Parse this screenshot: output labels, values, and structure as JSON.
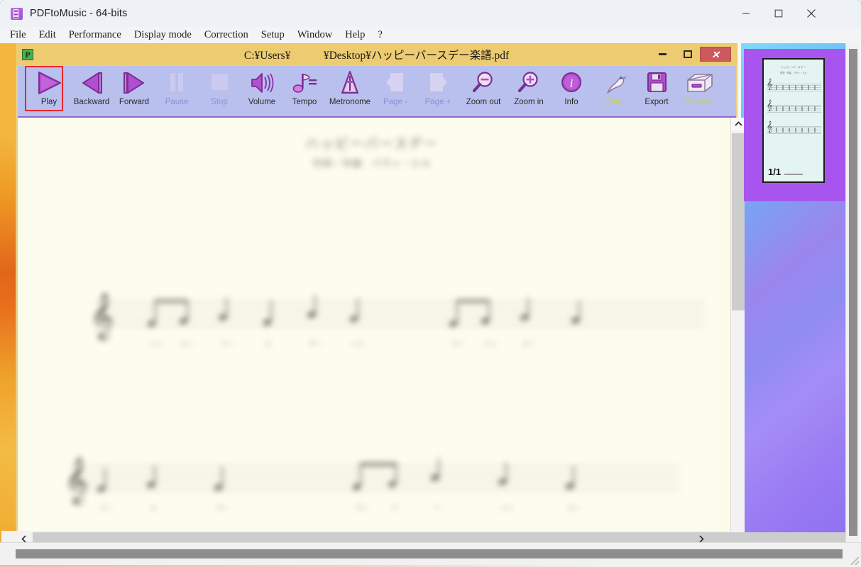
{
  "window": {
    "title": "PDFtoMusic - 64-bits",
    "app_icon": "pdf-icon",
    "controls": {
      "minimize": "minimize-icon",
      "maximize": "maximize-icon",
      "close": "close-icon"
    }
  },
  "menubar": {
    "items": [
      {
        "label": "File"
      },
      {
        "label": "Edit"
      },
      {
        "label": "Performance"
      },
      {
        "label": "Display mode"
      },
      {
        "label": "Correction"
      },
      {
        "label": "Setup"
      },
      {
        "label": "Window"
      },
      {
        "label": "Help"
      },
      {
        "label": "?"
      }
    ]
  },
  "document_window": {
    "icon_letter": "P",
    "title": "C:¥Users¥　　　¥Desktop¥ハッピーバースデー楽譜.pdf",
    "controls": {
      "minimize": "minimize-icon",
      "maximize": "maximize-icon",
      "close": "close-icon",
      "close_glyph": "✕"
    }
  },
  "toolbar": {
    "buttons": [
      {
        "label": "Play",
        "icon": "play-icon",
        "state": "enabled",
        "selected": true
      },
      {
        "label": "Backward",
        "icon": "backward-icon",
        "state": "enabled",
        "selected": false
      },
      {
        "label": "Forward",
        "icon": "forward-icon",
        "state": "enabled",
        "selected": false
      },
      {
        "label": "Pause",
        "icon": "pause-icon",
        "state": "disabled",
        "selected": false
      },
      {
        "label": "Stop",
        "icon": "stop-icon",
        "state": "disabled",
        "selected": false
      },
      {
        "label": "Volume",
        "icon": "volume-icon",
        "state": "enabled",
        "selected": false
      },
      {
        "label": "Tempo",
        "icon": "tempo-icon",
        "state": "enabled",
        "selected": false
      },
      {
        "label": "Metronome",
        "icon": "metronome-icon",
        "state": "enabled",
        "selected": false
      },
      {
        "label": "Page -",
        "icon": "page-prev-icon",
        "state": "disabled",
        "selected": false
      },
      {
        "label": "Page +",
        "icon": "page-next-icon",
        "state": "disabled",
        "selected": false
      },
      {
        "label": "Zoom out",
        "icon": "zoom-out-icon",
        "state": "enabled",
        "selected": false
      },
      {
        "label": "Zoom in",
        "icon": "zoom-in-icon",
        "state": "enabled",
        "selected": false
      },
      {
        "label": "Info",
        "icon": "info-icon",
        "state": "enabled",
        "selected": false
      },
      {
        "label": "Sing",
        "icon": "sing-bird-icon",
        "state": "special",
        "selected": false
      },
      {
        "label": "Export",
        "icon": "export-floppy-icon",
        "state": "enabled",
        "selected": false
      },
      {
        "label": "Drawer",
        "icon": "drawer-icon",
        "state": "special",
        "selected": false
      }
    ],
    "selection_color": "#e8262a",
    "disabled_label_color": "#8e90d9",
    "special_label_color": "#c8cf5a",
    "background_color": "#b9c0ee"
  },
  "sheet": {
    "title": "ハッピーバースデー",
    "subtitle": "作詞・作曲　パティ・ヒル",
    "staff_count_visible": 2,
    "note_hint": "blurred score content"
  },
  "thumbnail_panel": {
    "page_label": "1/1",
    "selected_background": "#a855f0",
    "page_background": "#e4f4f2"
  },
  "scrollbars": {
    "doc_vertical_up": "chevron-up-icon",
    "doc_vertical_down": "chevron-down-icon",
    "doc_horizontal_left": "chevron-left-icon",
    "doc_horizontal_right": "chevron-right-icon"
  },
  "desktop": {
    "left_strip_colors": [
      "#f3b73e",
      "#e2661a"
    ],
    "right_wallpaper_colors": [
      "#7ddcfb",
      "#8e6ff2"
    ]
  }
}
